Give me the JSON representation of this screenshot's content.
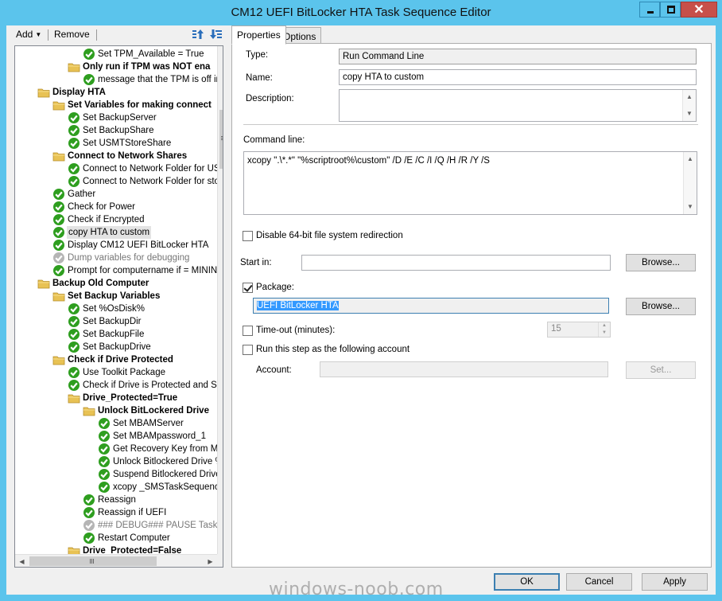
{
  "window": {
    "title": "CM12 UEFI BitLocker HTA Task Sequence Editor",
    "close_glyph": "✕"
  },
  "toolbar": {
    "add_label": "Add",
    "add_arrow": "▼",
    "remove_label": "Remove"
  },
  "tree": {
    "items": [
      {
        "label": "Set TPM_Available = True",
        "type": "step",
        "state": "ok",
        "indent": 3
      },
      {
        "label": "Only run if TPM was NOT ena",
        "type": "group",
        "indent": 2
      },
      {
        "label": "message that the TPM is off in t",
        "type": "step",
        "state": "ok",
        "indent": 3
      },
      {
        "label": "Display HTA",
        "type": "group",
        "indent": 0
      },
      {
        "label": "Set Variables for making connect",
        "type": "group",
        "indent": 1
      },
      {
        "label": "Set BackupServer",
        "type": "step",
        "state": "ok",
        "indent": 2
      },
      {
        "label": "Set BackupShare",
        "type": "step",
        "state": "ok",
        "indent": 2
      },
      {
        "label": "Set USMTStoreShare",
        "type": "step",
        "state": "ok",
        "indent": 2
      },
      {
        "label": "Connect to Network Shares",
        "type": "group",
        "indent": 1
      },
      {
        "label": "Connect to Network Folder for USM",
        "type": "step",
        "state": "ok",
        "indent": 2
      },
      {
        "label": "Connect to Network Folder for storin",
        "type": "step",
        "state": "ok",
        "indent": 2
      },
      {
        "label": "Gather",
        "type": "step",
        "state": "ok",
        "indent": 1
      },
      {
        "label": "Check for Power",
        "type": "step",
        "state": "ok",
        "indent": 1
      },
      {
        "label": "Check if Encrypted",
        "type": "step",
        "state": "ok",
        "indent": 1
      },
      {
        "label": "copy HTA to custom",
        "type": "step",
        "state": "ok",
        "indent": 1,
        "selected": true
      },
      {
        "label": "Display CM12 UEFI BitLocker HTA",
        "type": "step",
        "state": "ok",
        "indent": 1
      },
      {
        "label": "Dump variables for debugging",
        "type": "step",
        "state": "disabled",
        "indent": 1
      },
      {
        "label": "Prompt for computername if = MININT-",
        "type": "step",
        "state": "ok",
        "indent": 1
      },
      {
        "label": "Backup Old Computer",
        "type": "group",
        "indent": 0
      },
      {
        "label": "Set Backup Variables",
        "type": "group",
        "indent": 1
      },
      {
        "label": "Set %OsDisk%",
        "type": "step",
        "state": "ok",
        "indent": 2
      },
      {
        "label": "Set BackupDir",
        "type": "step",
        "state": "ok",
        "indent": 2
      },
      {
        "label": "Set BackupFile",
        "type": "step",
        "state": "ok",
        "indent": 2
      },
      {
        "label": "Set BackupDrive",
        "type": "step",
        "state": "ok",
        "indent": 2
      },
      {
        "label": "Check if Drive Protected",
        "type": "group",
        "indent": 1
      },
      {
        "label": "Use Toolkit Package",
        "type": "step",
        "state": "ok",
        "indent": 2
      },
      {
        "label": "Check if Drive is Protected and Set",
        "type": "step",
        "state": "ok",
        "indent": 2
      },
      {
        "label": "Drive_Protected=True",
        "type": "group",
        "indent": 2
      },
      {
        "label": "Unlock BitLockered Drive",
        "type": "group",
        "indent": 3
      },
      {
        "label": "Set MBAMServer",
        "type": "step",
        "state": "ok",
        "indent": 4
      },
      {
        "label": "Set MBAMpassword_1",
        "type": "step",
        "state": "ok",
        "indent": 4
      },
      {
        "label": "Get Recovery Key from MB",
        "type": "step",
        "state": "ok",
        "indent": 4
      },
      {
        "label": "Unlock Bitlockered Drive %",
        "type": "step",
        "state": "ok",
        "indent": 4
      },
      {
        "label": "Suspend Bitlockered Drive",
        "type": "step",
        "state": "ok",
        "indent": 4
      },
      {
        "label": "xcopy _SMSTaskSequence",
        "type": "step",
        "state": "ok",
        "indent": 4
      },
      {
        "label": "Reassign",
        "type": "step",
        "state": "ok",
        "indent": 3
      },
      {
        "label": "Reassign if UEFI",
        "type": "step",
        "state": "ok",
        "indent": 3
      },
      {
        "label": "### DEBUG### PAUSE Task",
        "type": "step",
        "state": "disabled",
        "indent": 3
      },
      {
        "label": "Restart Computer",
        "type": "step",
        "state": "ok",
        "indent": 3
      },
      {
        "label": "Drive_Protected=False",
        "type": "group",
        "indent": 2
      }
    ]
  },
  "tabs": [
    {
      "label": "Properties",
      "active": true
    },
    {
      "label": "Options",
      "active": false
    }
  ],
  "properties": {
    "type_label": "Type:",
    "type_value": "Run Command Line",
    "name_label": "Name:",
    "name_value": "copy HTA to custom",
    "description_label": "Description:",
    "description_value": "",
    "command_line_label": "Command line:",
    "command_line_value": "xcopy \".\\*.*\" \"%scriptroot%\\custom\" /D /E /C /I /Q /H /R /Y /S",
    "disable_redirection_label": "Disable 64-bit file system redirection",
    "disable_redirection_checked": false,
    "start_in_label": "Start in:",
    "start_in_value": "",
    "browse_label": "Browse...",
    "package_label": "Package:",
    "package_checked": true,
    "package_value": "UEFI BitLocker HTA",
    "timeout_label": "Time-out (minutes):",
    "timeout_checked": false,
    "timeout_value": "15",
    "run_as_label": "Run this step as the following account",
    "run_as_checked": false,
    "account_label": "Account:",
    "account_value": "",
    "set_label": "Set..."
  },
  "dialog": {
    "ok_label": "OK",
    "cancel_label": "Cancel",
    "apply_label": "Apply"
  },
  "watermark": "windows-noob.com",
  "colors": {
    "titlebar": "#5bc4ec",
    "close_button": "#c7504a",
    "step_ok": "#2e9e1f",
    "step_disabled": "#b5b5b5",
    "folder": "#e8c254",
    "selection": "#3399ff"
  }
}
